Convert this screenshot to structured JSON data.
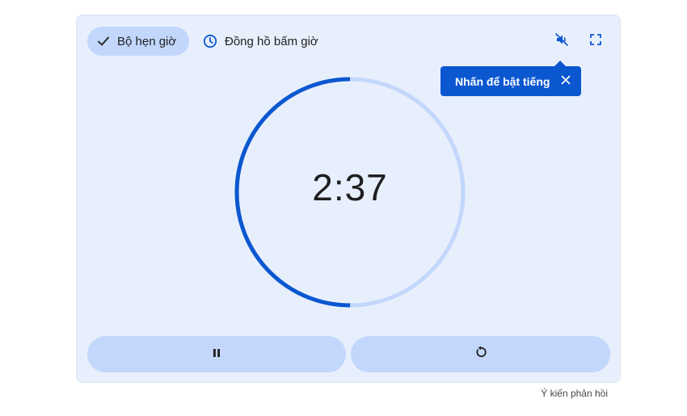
{
  "tabs": {
    "timer_label": "Bộ hẹn giờ",
    "stopwatch_label": "Đồng hồ bấm giờ"
  },
  "tooltip": {
    "text": "Nhấn để bật tiếng"
  },
  "timer": {
    "display": "2:37",
    "progress_fraction": 0.5
  },
  "footer": {
    "feedback_label": "Ý kiến phản hồi"
  },
  "colors": {
    "card_bg": "#e8effc",
    "accent": "#0b57d0",
    "ring_active": "#0b57d0",
    "ring_track": "#c2d7fb",
    "button_bg": "#c2d7fb"
  },
  "icons": {
    "timer_tab": "check-icon",
    "stopwatch_tab": "clock-icon",
    "mute": "volume-off-icon",
    "fullscreen": "fullscreen-icon",
    "tooltip_close": "close-icon",
    "pause": "pause-icon",
    "reset": "reset-icon"
  }
}
